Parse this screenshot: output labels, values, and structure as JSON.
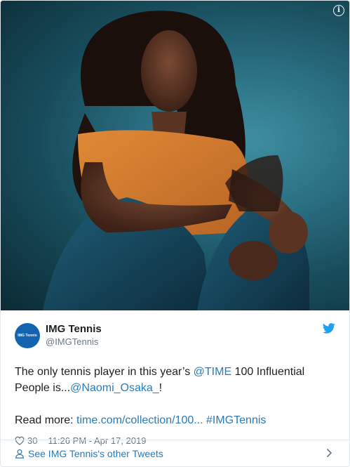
{
  "tweet": {
    "avatar_text": "IMG Tennis",
    "display_name": "IMG Tennis",
    "handle": "@IMGTennis",
    "text": {
      "part1": "The only tennis player in this year’s ",
      "mention_time": "@TIME",
      "part2": " 100 Influential People is...",
      "mention_osaka": "@Naomi_Osaka_",
      "part3": "!",
      "read_more": "Read more: ",
      "link": "time.com/collection/100...",
      "space": " ",
      "hashtag": "#IMGTennis"
    },
    "likes": "30",
    "timestamp": "11:26 PM - Apr 17, 2019"
  },
  "footer": {
    "label": "See IMG Tennis's other Tweets"
  },
  "colors": {
    "link": "#2b7bb9",
    "twitter_blue": "#1da1f2",
    "muted": "#697882",
    "avatar_bg": "#1363b0"
  },
  "icons": [
    "info-icon",
    "twitter-bird-icon",
    "heart-icon",
    "person-icon",
    "chevron-right-icon"
  ]
}
